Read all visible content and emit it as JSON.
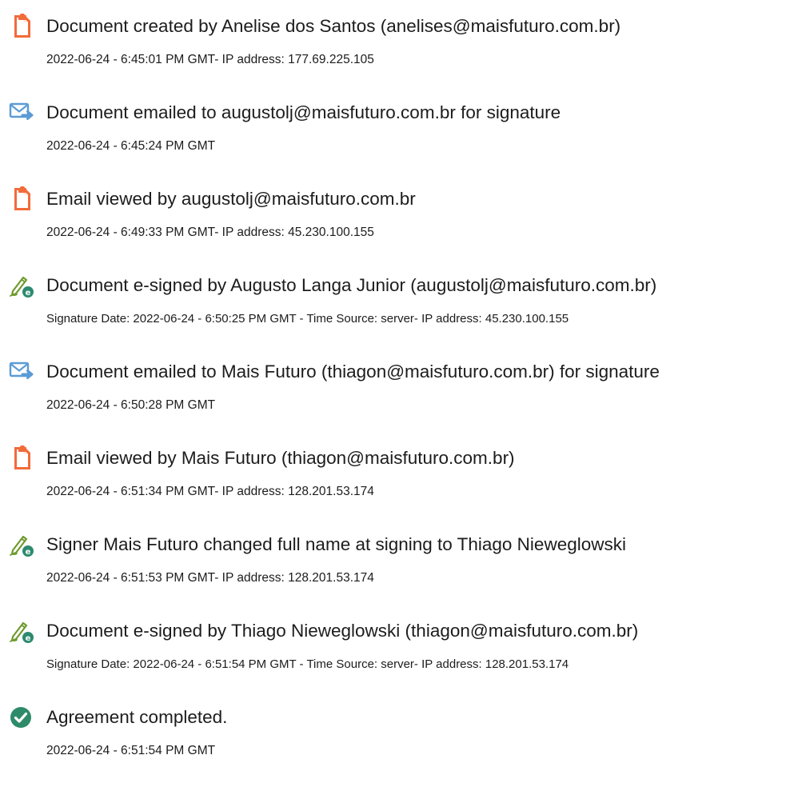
{
  "events": [
    {
      "icon": "document-created-icon",
      "title": "Document created by Anelise dos Santos (anelises@maisfuturo.com.br)",
      "detail": "2022-06-24 - 6:45:01 PM GMT- IP address: 177.69.225.105"
    },
    {
      "icon": "email-sent-icon",
      "title": "Document emailed to augustolj@maisfuturo.com.br for signature",
      "detail": "2022-06-24 - 6:45:24 PM GMT"
    },
    {
      "icon": "document-viewed-icon",
      "title": "Email viewed by augustolj@maisfuturo.com.br",
      "detail": "2022-06-24 - 6:49:33 PM GMT- IP address: 45.230.100.155"
    },
    {
      "icon": "e-sign-pen-icon",
      "title": "Document e-signed by Augusto Langa Junior (augustolj@maisfuturo.com.br)",
      "detail": "Signature Date: 2022-06-24 - 6:50:25 PM GMT - Time Source: server- IP address: 45.230.100.155"
    },
    {
      "icon": "email-sent-icon",
      "title": "Document emailed to Mais Futuro (thiagon@maisfuturo.com.br) for signature",
      "detail": "2022-06-24 - 6:50:28 PM GMT"
    },
    {
      "icon": "document-viewed-icon",
      "title": "Email viewed by Mais Futuro (thiagon@maisfuturo.com.br)",
      "detail": "2022-06-24 - 6:51:34 PM GMT- IP address: 128.201.53.174"
    },
    {
      "icon": "e-sign-pen-icon",
      "title": "Signer Mais Futuro changed full name at signing to Thiago Nieweglowski",
      "detail": "2022-06-24 - 6:51:53 PM GMT- IP address: 128.201.53.174"
    },
    {
      "icon": "e-sign-pen-icon",
      "title": "Document e-signed by Thiago Nieweglowski (thiagon@maisfuturo.com.br)",
      "detail": "Signature Date: 2022-06-24 - 6:51:54 PM GMT - Time Source: server- IP address: 128.201.53.174"
    },
    {
      "icon": "check-circle-icon",
      "title": "Agreement completed.",
      "detail": "2022-06-24 - 6:51:54 PM GMT"
    }
  ],
  "colors": {
    "document_icon": "#f26b3a",
    "email_icon": "#5b9bd5",
    "pen_icon": "#6f9a2f",
    "badge": "#2c8a6f",
    "check": "#2e8b6a"
  }
}
